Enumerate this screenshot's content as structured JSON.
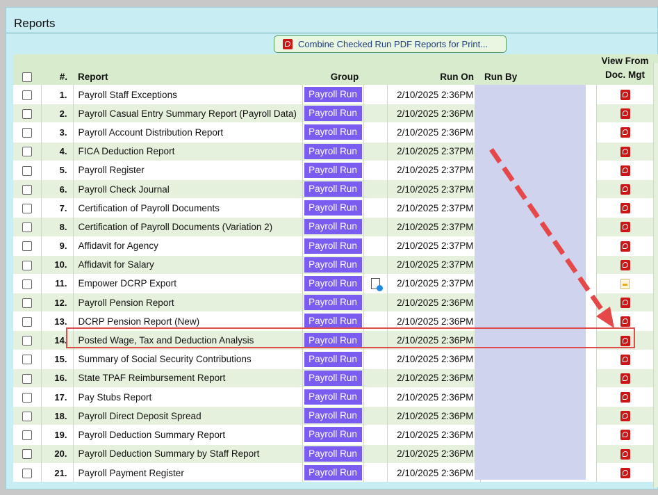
{
  "panel": {
    "title": "Reports",
    "combine_button_label": "Combine Checked Run PDF Reports for Print..."
  },
  "table": {
    "headers": {
      "number": "#.",
      "report": "Report",
      "group": "Group",
      "run_on": "Run On",
      "run_by": "Run By",
      "view_line1": "View From",
      "view_line2": "Doc. Mgt"
    },
    "rows": [
      {
        "num": "1.",
        "report": "Payroll Staff Exceptions",
        "group": "Payroll Run",
        "run_on": "2/10/2025 2:36PM",
        "icon": "pdf-icon"
      },
      {
        "num": "2.",
        "report": "Payroll Casual Entry Summary Report (Payroll Data)",
        "group": "Payroll Run",
        "run_on": "2/10/2025 2:36PM",
        "icon": "pdf-icon"
      },
      {
        "num": "3.",
        "report": "Payroll Account Distribution Report",
        "group": "Payroll Run",
        "run_on": "2/10/2025 2:36PM",
        "icon": "pdf-icon"
      },
      {
        "num": "4.",
        "report": "FICA Deduction Report",
        "group": "Payroll Run",
        "run_on": "2/10/2025 2:37PM",
        "icon": "pdf-icon"
      },
      {
        "num": "5.",
        "report": "Payroll Register",
        "group": "Payroll Run",
        "run_on": "2/10/2025 2:37PM",
        "icon": "pdf-icon"
      },
      {
        "num": "6.",
        "report": "Payroll Check Journal",
        "group": "Payroll Run",
        "run_on": "2/10/2025 2:37PM",
        "icon": "pdf-icon"
      },
      {
        "num": "7.",
        "report": "Certification of Payroll Documents",
        "group": "Payroll Run",
        "run_on": "2/10/2025 2:37PM",
        "icon": "pdf-icon"
      },
      {
        "num": "8.",
        "report": "Certification of Payroll Documents (Variation 2)",
        "group": "Payroll Run",
        "run_on": "2/10/2025 2:37PM",
        "icon": "pdf-icon"
      },
      {
        "num": "9.",
        "report": "Affidavit for Agency",
        "group": "Payroll Run",
        "run_on": "2/10/2025 2:37PM",
        "icon": "pdf-icon"
      },
      {
        "num": "10.",
        "report": "Affidavit for Salary",
        "group": "Payroll Run",
        "run_on": "2/10/2025 2:37PM",
        "icon": "pdf-icon"
      },
      {
        "num": "11.",
        "report": "Empower DCRP Export",
        "group": "Payroll Run",
        "run_on": "2/10/2025 2:37PM",
        "icon": "csv-icon",
        "extra_icon": "document-download-icon"
      },
      {
        "num": "12.",
        "report": "Payroll Pension Report",
        "group": "Payroll Run",
        "run_on": "2/10/2025 2:36PM",
        "icon": "pdf-icon"
      },
      {
        "num": "13.",
        "report": "DCRP Pension Report (New)",
        "group": "Payroll Run",
        "run_on": "2/10/2025 2:36PM",
        "icon": "pdf-icon"
      },
      {
        "num": "14.",
        "report": "Posted Wage, Tax and Deduction Analysis",
        "group": "Payroll Run",
        "run_on": "2/10/2025 2:36PM",
        "icon": "pdf-icon",
        "highlighted": true
      },
      {
        "num": "15.",
        "report": "Summary of Social Security Contributions",
        "group": "Payroll Run",
        "run_on": "2/10/2025 2:36PM",
        "icon": "pdf-icon"
      },
      {
        "num": "16.",
        "report": "State TPAF Reimbursement Report",
        "group": "Payroll Run",
        "run_on": "2/10/2025 2:36PM",
        "icon": "pdf-icon"
      },
      {
        "num": "17.",
        "report": "Pay Stubs Report",
        "group": "Payroll Run",
        "run_on": "2/10/2025 2:36PM",
        "icon": "pdf-icon"
      },
      {
        "num": "18.",
        "report": "Payroll Direct Deposit Spread",
        "group": "Payroll Run",
        "run_on": "2/10/2025 2:36PM",
        "icon": "pdf-icon"
      },
      {
        "num": "19.",
        "report": "Payroll Deduction Summary Report",
        "group": "Payroll Run",
        "run_on": "2/10/2025 2:36PM",
        "icon": "pdf-icon"
      },
      {
        "num": "20.",
        "report": "Payroll Deduction Summary by Staff Report",
        "group": "Payroll Run",
        "run_on": "2/10/2025 2:36PM",
        "icon": "pdf-icon"
      },
      {
        "num": "21.",
        "report": "Payroll Payment Register",
        "group": "Payroll Run",
        "run_on": "2/10/2025 2:36PM",
        "icon": "pdf-icon"
      }
    ]
  },
  "annotation": {
    "highlight_color": "#e04b4b",
    "arrow_color": "#e54848"
  },
  "colors": {
    "group_badge": "#7a5cf0",
    "header_bg": "#d8ebcd",
    "alt_row_bg": "#e6f1dd",
    "panel_bg": "#c8eef3"
  }
}
